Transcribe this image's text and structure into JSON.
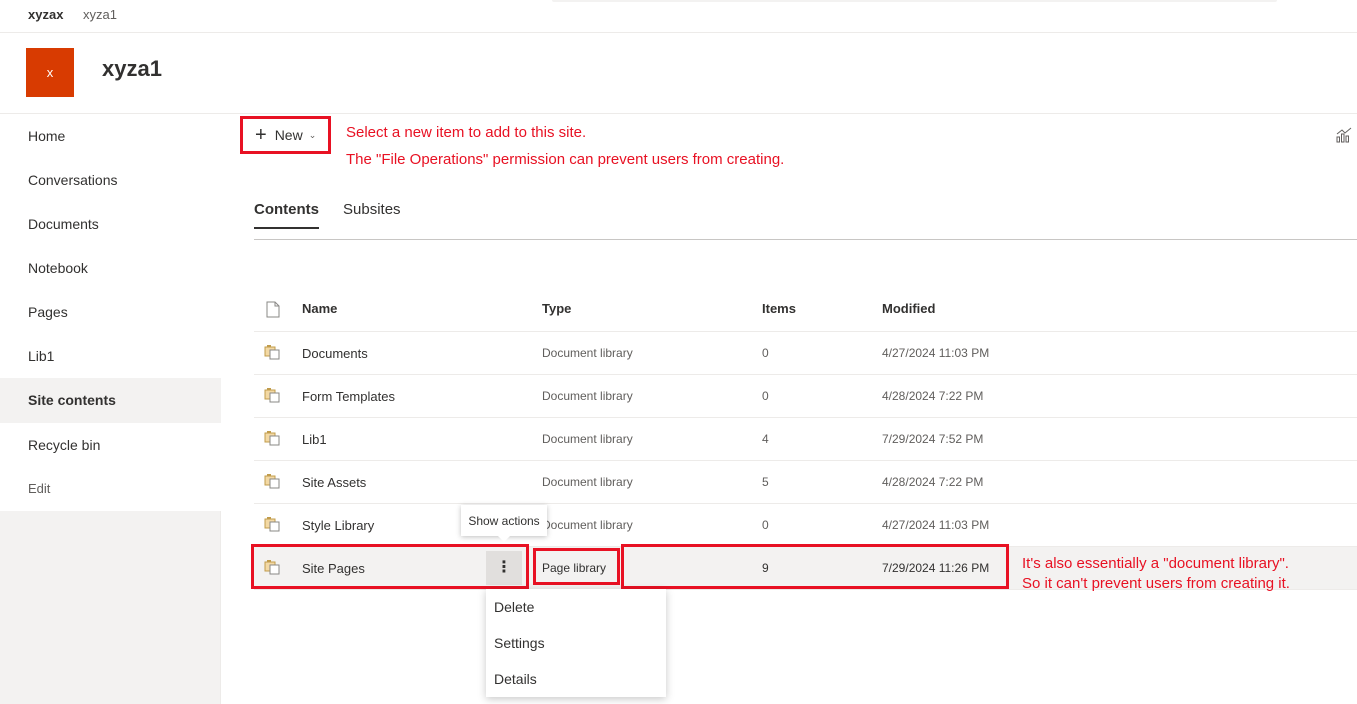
{
  "topbar": {
    "hub": "xyzax",
    "site": "xyza1"
  },
  "site": {
    "logo_letter": "x",
    "title": "xyza1"
  },
  "nav": {
    "items": [
      {
        "label": "Home",
        "selected": false
      },
      {
        "label": "Conversations",
        "selected": false
      },
      {
        "label": "Documents",
        "selected": false
      },
      {
        "label": "Notebook",
        "selected": false
      },
      {
        "label": "Pages",
        "selected": false
      },
      {
        "label": "Lib1",
        "selected": false
      },
      {
        "label": "Site contents",
        "selected": true
      },
      {
        "label": "Recycle bin",
        "selected": false
      }
    ],
    "edit_label": "Edit"
  },
  "toolbar": {
    "new_label": "New",
    "new_icon": "plus-icon",
    "chevron_icon": "chevron-down-icon",
    "corner_icon": "analytics-icon"
  },
  "annotations": {
    "new_line1": "Select a new item to add to this site.",
    "new_line2": "The \"File Operations\" permission can prevent users from creating.",
    "row_line1": "It's also essentially  a \"document library\".",
    "row_line2": "So it can't prevent users from creating it.",
    "color": "#e81123"
  },
  "tabs": [
    {
      "label": "Contents",
      "active": true
    },
    {
      "label": "Subsites",
      "active": false
    }
  ],
  "table": {
    "header_icon": "document-icon",
    "columns": {
      "name": "Name",
      "type": "Type",
      "items": "Items",
      "modified": "Modified"
    },
    "row_icon": "library-icon",
    "rows": [
      {
        "name": "Documents",
        "type": "Document library",
        "items": "0",
        "modified": "4/27/2024 11:03 PM"
      },
      {
        "name": "Form Templates",
        "type": "Document library",
        "items": "0",
        "modified": "4/28/2024 7:22 PM"
      },
      {
        "name": "Lib1",
        "type": "Document library",
        "items": "4",
        "modified": "7/29/2024 7:52 PM"
      },
      {
        "name": "Site Assets",
        "type": "Document library",
        "items": "5",
        "modified": "4/28/2024 7:22 PM"
      },
      {
        "name": "Style Library",
        "type": "Document library",
        "items": "0",
        "modified": "4/27/2024 11:03 PM"
      },
      {
        "name": "Site Pages",
        "type": "Page library",
        "items": "9",
        "modified": "7/29/2024 11:26 PM",
        "selected": true
      }
    ]
  },
  "tooltip": {
    "text": "Show actions"
  },
  "more_glyph": "⋮",
  "context_menu": {
    "items": [
      "Delete",
      "Settings",
      "Details"
    ]
  },
  "colors": {
    "brand": "#d83b01",
    "highlight": "#e81123",
    "selected_bg": "#f3f2f1"
  }
}
